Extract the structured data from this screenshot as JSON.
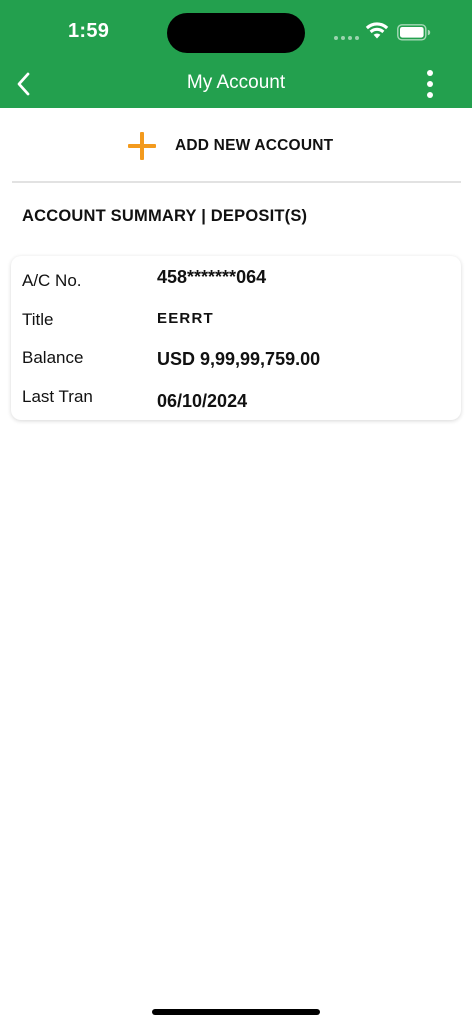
{
  "status_bar": {
    "time": "1:59"
  },
  "nav": {
    "title": "My Account",
    "back_icon": "chevron-left-icon",
    "more_icon": "vertical-ellipsis-icon"
  },
  "actions": {
    "add_account_label": "ADD NEW ACCOUNT",
    "add_icon": "plus-icon"
  },
  "section": {
    "title": "ACCOUNT SUMMARY | DEPOSIT(S)"
  },
  "account": {
    "ac_no_label": "A/C No.",
    "ac_no_value": "458*******064",
    "title_label": "Title",
    "title_value": "EERRT",
    "balance_label": "Balance",
    "balance_value": "USD 9,99,99,759.00",
    "last_tran_label": "Last Tran",
    "last_tran_value": "06/10/2024"
  },
  "colors": {
    "header_green": "#23a04e",
    "accent_orange": "#f39a1d",
    "text": "#111111",
    "background": "#ffffff"
  }
}
